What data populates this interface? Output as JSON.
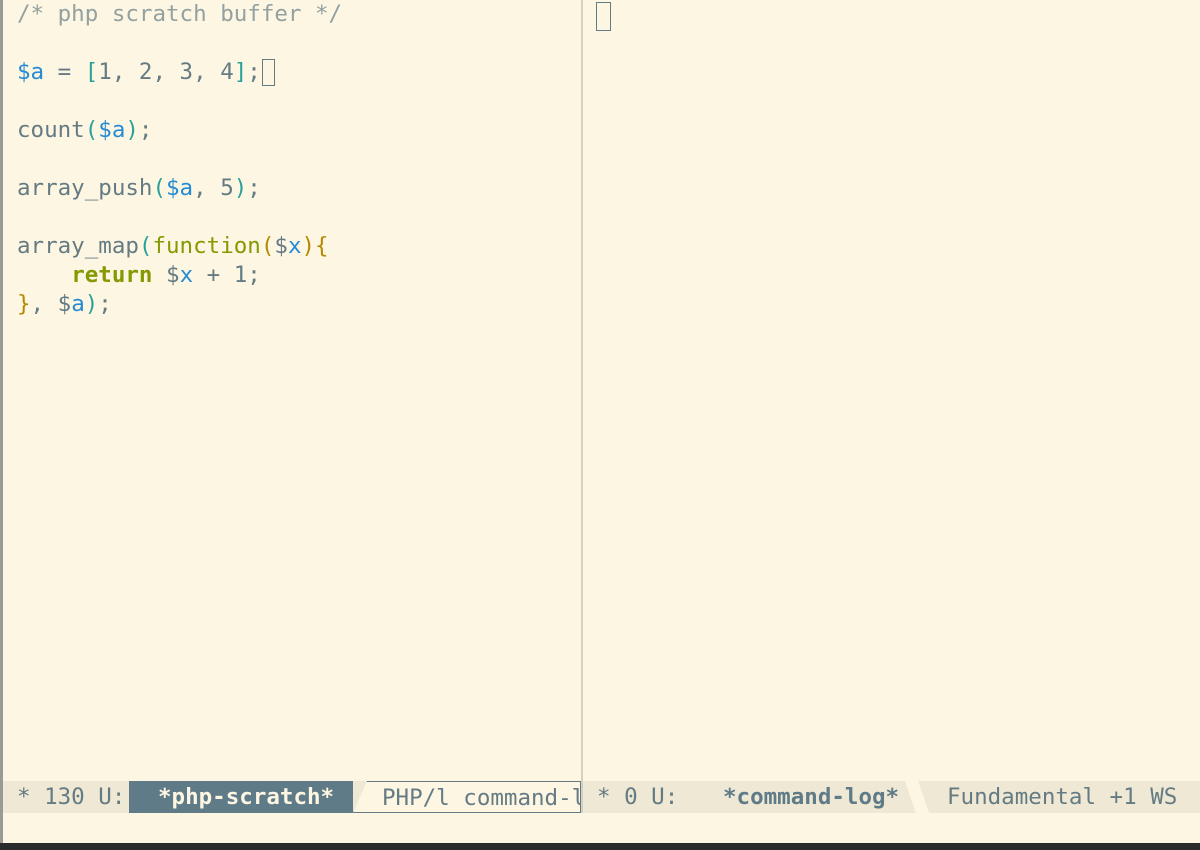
{
  "windows": {
    "left": {
      "lines": {
        "comment": "/* php scratch buffer */",
        "l3_var": "$a",
        "l3_op": " = ",
        "l3_open": "[",
        "l3_nums": "1, 2, 3, 4",
        "l3_close": "]",
        "l3_semi": ";",
        "l5_fn": "count",
        "l5_open": "(",
        "l5_var": "$a",
        "l5_close": ")",
        "l5_semi": ";",
        "l7_fn": "array_push",
        "l7_open": "(",
        "l7_var": "$a",
        "l7_rest": ", 5",
        "l7_close": ")",
        "l7_semi": ";",
        "l9_fn": "array_map",
        "l9_open": "(",
        "l9_kw": "function",
        "l9_popen": "(",
        "l9_dollar": "$",
        "l9_var": "x",
        "l9_pclose": ")",
        "l9_brace": "{",
        "l10_indent": "    ",
        "l10_kw": "return",
        "l10_dollar": " $",
        "l10_var": "x",
        "l10_rest": " + 1;",
        "l11_brace": "}",
        "l11_comma": ", ",
        "l11_dollar": "$",
        "l11_var": "a",
        "l11_close": ")",
        "l11_semi": ";"
      }
    }
  },
  "modeline": {
    "left": {
      "status": "* 130 U:",
      "buffer_name": "*php-scratch*",
      "mode": "PHP/l command-l"
    },
    "right": {
      "status": "* 0 U:",
      "buffer_name": "*command-log*",
      "mode": "Fundamental +1 WS"
    }
  },
  "colors": {
    "background": "#fdf6e3",
    "foreground": "#657b83",
    "comment": "#93a1a1",
    "variable": "#268bd2",
    "keyword": "#859900",
    "bracket_depth1": "#2aa198",
    "bracket_depth2": "#b58900",
    "modeline_active_buffer": "#5f7b88"
  }
}
